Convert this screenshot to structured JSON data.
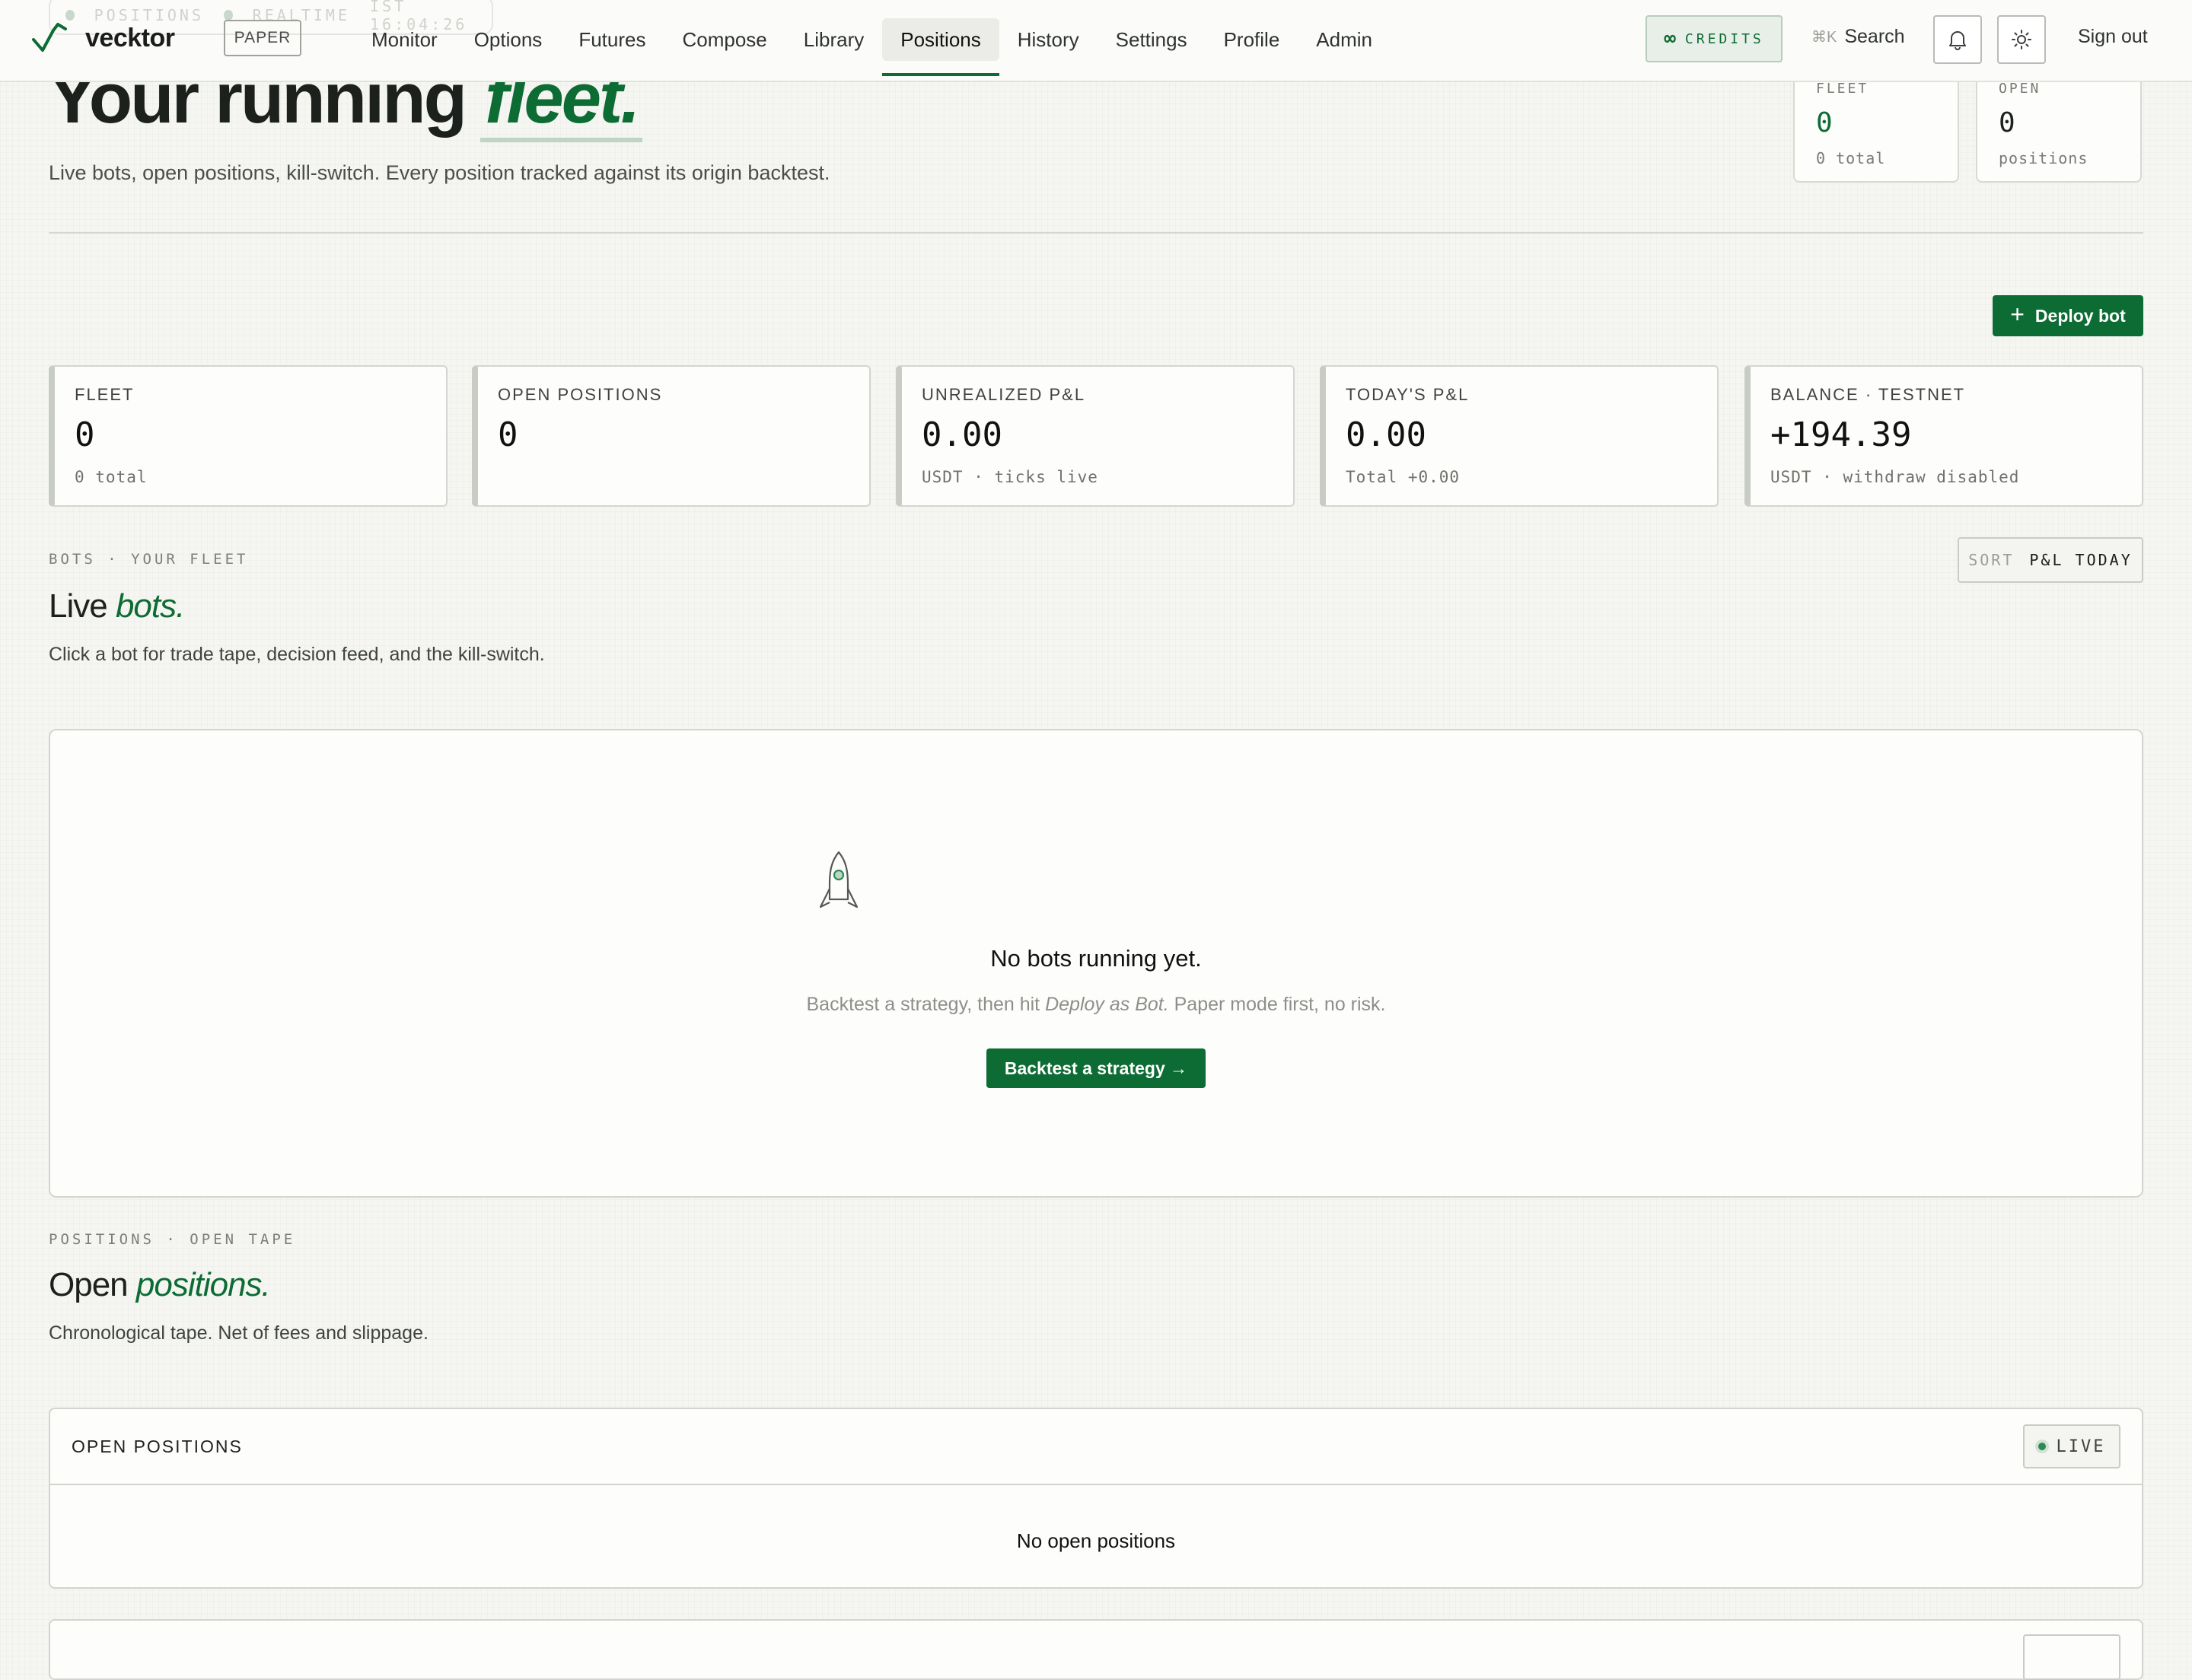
{
  "ghost_bar": {
    "section": "POSITIONS",
    "mode": "REALTIME",
    "clock": "IST 16:04:26"
  },
  "brand": {
    "name": "vecktor",
    "mode_badge": "PAPER",
    "accent_color": "#0d6b34"
  },
  "nav": {
    "links": [
      "Monitor",
      "Options",
      "Futures",
      "Compose",
      "Library",
      "Positions",
      "History",
      "Settings",
      "Profile",
      "Admin"
    ],
    "active": "Positions",
    "credits_label": "CREDITS",
    "credits_symbol": "∞",
    "search_shortcut": "⌘K",
    "search_label": "Search",
    "signout_label": "Sign out"
  },
  "hero": {
    "title_prefix": "Your running",
    "title_accent": "fleet.",
    "subtitle": "Live bots, open positions, kill-switch. Every position tracked against its origin backtest.",
    "mini_cards": [
      {
        "label": "FLEET",
        "value": "0",
        "sub": "0 total"
      },
      {
        "label": "OPEN",
        "value": "0",
        "sub": "positions"
      }
    ]
  },
  "deploy_button": {
    "icon": "+",
    "label": "Deploy bot"
  },
  "stats": [
    {
      "label": "FLEET",
      "value": "0",
      "sub": "0 total"
    },
    {
      "label": "OPEN POSITIONS",
      "value": "0",
      "sub": ""
    },
    {
      "label": "UNREALIZED P&L",
      "value": "0.00",
      "sub": "USDT · ticks live"
    },
    {
      "label": "TODAY'S P&L",
      "value": "0.00",
      "sub": "Total +0.00"
    },
    {
      "label": "BALANCE · TESTNET",
      "value": "+194.39",
      "sub": "USDT · withdraw disabled"
    }
  ],
  "bots_section": {
    "kicker": "BOTS · YOUR FLEET",
    "title_prefix": "Live",
    "title_accent": "bots.",
    "subtitle": "Click a bot for trade tape, decision feed, and the kill-switch.",
    "sort_label": "SORT",
    "sort_value": "P&L TODAY",
    "empty": {
      "title": "No bots running yet.",
      "sub_before": "Backtest a strategy, then hit",
      "sub_em": "Deploy as Bot.",
      "sub_after": "Paper mode first, no risk.",
      "cta": "Backtest a strategy →"
    }
  },
  "positions_section": {
    "kicker": "POSITIONS · OPEN TAPE",
    "title_prefix": "Open",
    "title_accent": "positions.",
    "subtitle": "Chronological tape. Net of fees and slippage.",
    "table_label": "OPEN POSITIONS",
    "live_label": "LIVE",
    "empty_text": "No open positions"
  }
}
